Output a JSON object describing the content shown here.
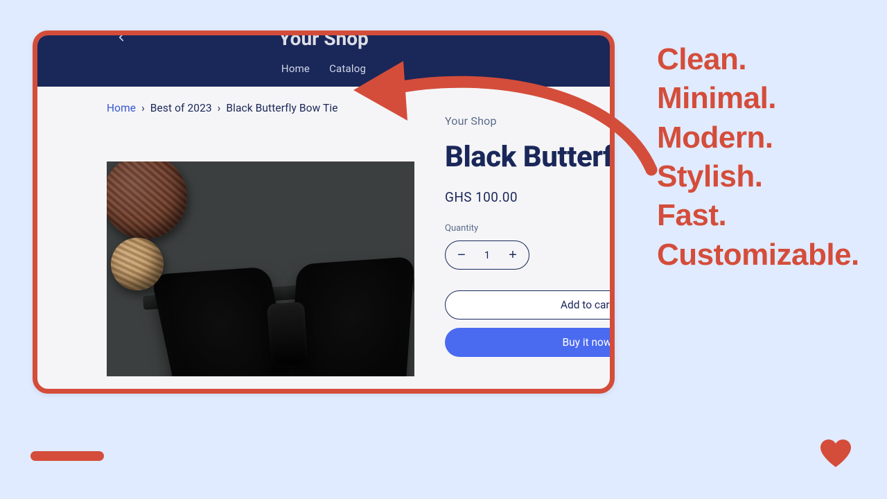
{
  "nav": {
    "home": "Home",
    "catalog": "Catalog"
  },
  "brand_cut": "Your Shop",
  "breadcrumbs": {
    "home": "Home",
    "mid": "Best of 2023",
    "last": "Black Butterfly Bow Tie",
    "sep": "›"
  },
  "product": {
    "vendor": "Your Shop",
    "title": "Black Butterf",
    "price": "GHS 100.00",
    "qty_label": "Quantity",
    "qty_value": "1",
    "add_to_cart": "Add to cart",
    "buy_now": "Buy it now"
  },
  "callout": {
    "l1": "Clean.",
    "l2": "Minimal.",
    "l3": "Modern.",
    "l4": "Stylish.",
    "l5": "Fast.",
    "l6": "Customizable."
  },
  "colors": {
    "accent": "#d44d3a",
    "brand_navy": "#1a2759",
    "cta_blue": "#4a6af0"
  }
}
